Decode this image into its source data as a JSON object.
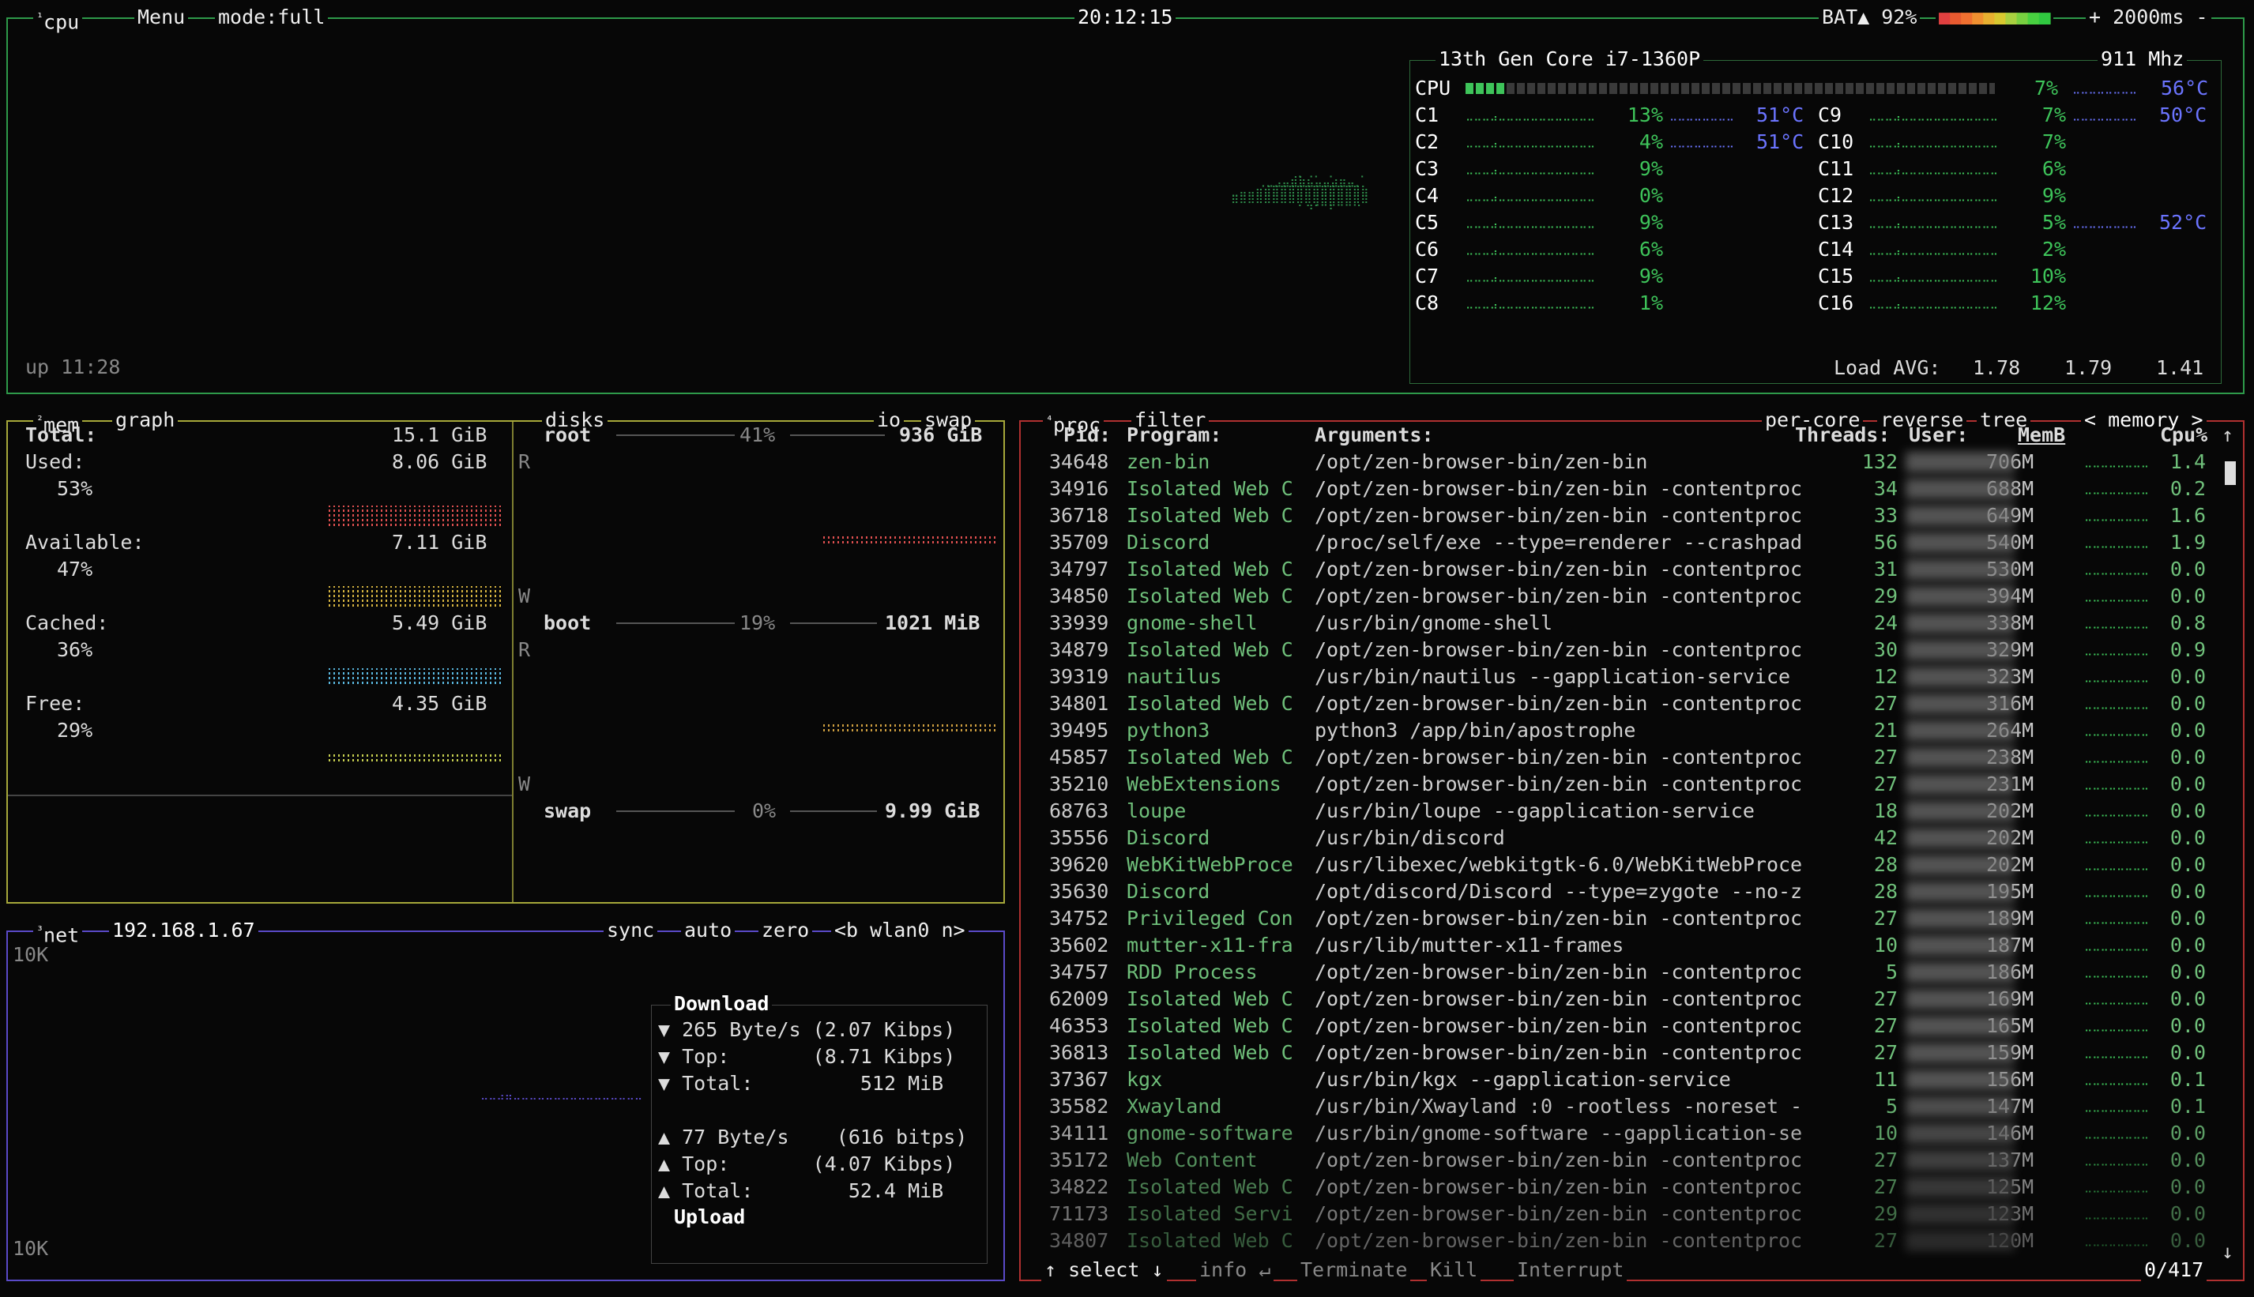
{
  "cpu_box": {
    "tab_num": "¹",
    "tab": "cpu",
    "menu": "Menu",
    "mode": "mode:full",
    "clock": "20:12:15",
    "battery": "BAT▲ 92%",
    "battery_level": 0.92,
    "refresh": "+ 2000ms -",
    "uptime": "up 11:28",
    "model": "13th Gen Core i7-1360P",
    "freq": "911 Mhz",
    "total": {
      "label": "CPU",
      "pct": "7%",
      "temp": "56°C",
      "value": 7
    },
    "cores_left": [
      {
        "name": "C1",
        "pct": "13%",
        "temp": "51°C"
      },
      {
        "name": "C2",
        "pct": "4%",
        "temp": "51°C"
      },
      {
        "name": "C3",
        "pct": "9%",
        "temp": ""
      },
      {
        "name": "C4",
        "pct": "0%",
        "temp": ""
      },
      {
        "name": "C5",
        "pct": "9%",
        "temp": ""
      },
      {
        "name": "C6",
        "pct": "6%",
        "temp": ""
      },
      {
        "name": "C7",
        "pct": "9%",
        "temp": ""
      },
      {
        "name": "C8",
        "pct": "1%",
        "temp": ""
      }
    ],
    "cores_right": [
      {
        "name": "C9",
        "pct": "7%",
        "temp": "50°C"
      },
      {
        "name": "C10",
        "pct": "7%",
        "temp": ""
      },
      {
        "name": "C11",
        "pct": "6%",
        "temp": ""
      },
      {
        "name": "C12",
        "pct": "9%",
        "temp": ""
      },
      {
        "name": "C13",
        "pct": "5%",
        "temp": "52°C"
      },
      {
        "name": "C14",
        "pct": "2%",
        "temp": ""
      },
      {
        "name": "C15",
        "pct": "10%",
        "temp": ""
      },
      {
        "name": "C16",
        "pct": "12%",
        "temp": ""
      }
    ],
    "load_label": "Load AVG:",
    "load": [
      "1.78",
      "1.79",
      "1.41"
    ]
  },
  "mem_box": {
    "tab_num": "²",
    "tab": "mem",
    "graph": "graph",
    "disks": "disks",
    "io": "io",
    "swap": "swap",
    "total_label": "Total:",
    "total": "15.1 GiB",
    "used_label": "Used:",
    "used": "8.06 GiB",
    "used_pct": "53%",
    "avail_label": "Available:",
    "avail": "7.11 GiB",
    "avail_pct": "47%",
    "cached_label": "Cached:",
    "cached": "5.49 GiB",
    "cached_pct": "36%",
    "free_label": "Free:",
    "free": "4.35 GiB",
    "free_pct": "29%",
    "disk_list": [
      {
        "name": "root",
        "pct": "41%",
        "size": "936 GiB"
      },
      {
        "name": "boot",
        "pct": "19%",
        "size": "1021 MiB"
      },
      {
        "name": "swap",
        "pct": "0%",
        "size": "9.99 GiB"
      }
    ],
    "r": "R",
    "w": "W"
  },
  "net_box": {
    "tab_num": "³",
    "tab": "net",
    "ip": "192.168.1.67",
    "sync": "sync",
    "auto": "auto",
    "zero": "zero",
    "iface": "<b wlan0 n>",
    "scale_top": "10K",
    "scale_bottom": "10K",
    "download_title": "Download",
    "upload_title": "Upload",
    "down": [
      "▼ 265 Byte/s (2.07 Kibps)",
      "▼ Top:       (8.71 Kibps)",
      "▼ Total:         512 MiB"
    ],
    "up": [
      "▲ 77 Byte/s    (616 bitps)",
      "▲ Top:       (4.07 Kibps)",
      "▲ Total:        52.4 MiB"
    ]
  },
  "proc_box": {
    "tab_num": "⁴",
    "tab": "proc",
    "filter": "filter",
    "per_core": "per-core",
    "reverse": "reverse",
    "tree": "tree",
    "sort": "< memory >",
    "headers": {
      "pid": "Pid:",
      "program": "Program:",
      "args": "Arguments:",
      "threads": "Threads:",
      "user": "User:",
      "mem": "MemB",
      "cpu": "Cpu%"
    },
    "rows": [
      [
        "34648",
        "zen-bin",
        "/opt/zen-browser-bin/zen-bin",
        "132",
        "706M",
        "1.4"
      ],
      [
        "34916",
        "Isolated Web C",
        "/opt/zen-browser-bin/zen-bin -contentproc",
        "34",
        "688M",
        "0.2"
      ],
      [
        "36718",
        "Isolated Web C",
        "/opt/zen-browser-bin/zen-bin -contentproc",
        "33",
        "649M",
        "1.6"
      ],
      [
        "35709",
        "Discord",
        "/proc/self/exe --type=renderer --crashpad",
        "56",
        "540M",
        "1.9"
      ],
      [
        "34797",
        "Isolated Web C",
        "/opt/zen-browser-bin/zen-bin -contentproc",
        "31",
        "530M",
        "0.0"
      ],
      [
        "34850",
        "Isolated Web C",
        "/opt/zen-browser-bin/zen-bin -contentproc",
        "29",
        "394M",
        "0.0"
      ],
      [
        "33939",
        "gnome-shell",
        "/usr/bin/gnome-shell",
        "24",
        "338M",
        "0.8"
      ],
      [
        "34879",
        "Isolated Web C",
        "/opt/zen-browser-bin/zen-bin -contentproc",
        "30",
        "329M",
        "0.9"
      ],
      [
        "39319",
        "nautilus",
        "/usr/bin/nautilus --gapplication-service",
        "12",
        "323M",
        "0.0"
      ],
      [
        "34801",
        "Isolated Web C",
        "/opt/zen-browser-bin/zen-bin -contentproc",
        "27",
        "316M",
        "0.0"
      ],
      [
        "39495",
        "python3",
        "python3 /app/bin/apostrophe",
        "21",
        "264M",
        "0.0"
      ],
      [
        "45857",
        "Isolated Web C",
        "/opt/zen-browser-bin/zen-bin -contentproc",
        "27",
        "238M",
        "0.0"
      ],
      [
        "35210",
        "WebExtensions",
        "/opt/zen-browser-bin/zen-bin -contentproc",
        "27",
        "231M",
        "0.0"
      ],
      [
        "68763",
        "loupe",
        "/usr/bin/loupe --gapplication-service",
        "18",
        "202M",
        "0.0"
      ],
      [
        "35556",
        "Discord",
        "/usr/bin/discord",
        "42",
        "202M",
        "0.0"
      ],
      [
        "39620",
        "WebKitWebProce",
        "/usr/libexec/webkitgtk-6.0/WebKitWebProce",
        "28",
        "202M",
        "0.0"
      ],
      [
        "35630",
        "Discord",
        "/opt/discord/Discord --type=zygote --no-z",
        "28",
        "195M",
        "0.0"
      ],
      [
        "34752",
        "Privileged Con",
        "/opt/zen-browser-bin/zen-bin -contentproc",
        "27",
        "189M",
        "0.0"
      ],
      [
        "35602",
        "mutter-x11-fra",
        "/usr/lib/mutter-x11-frames",
        "10",
        "187M",
        "0.0"
      ],
      [
        "34757",
        "RDD Process",
        "/opt/zen-browser-bin/zen-bin -contentproc",
        "5",
        "186M",
        "0.0"
      ],
      [
        "62009",
        "Isolated Web C",
        "/opt/zen-browser-bin/zen-bin -contentproc",
        "27",
        "169M",
        "0.0"
      ],
      [
        "46353",
        "Isolated Web C",
        "/opt/zen-browser-bin/zen-bin -contentproc",
        "27",
        "165M",
        "0.0"
      ],
      [
        "36813",
        "Isolated Web C",
        "/opt/zen-browser-bin/zen-bin -contentproc",
        "27",
        "159M",
        "0.0"
      ],
      [
        "37367",
        "kgx",
        "/usr/bin/kgx --gapplication-service",
        "11",
        "156M",
        "0.1"
      ],
      [
        "35582",
        "Xwayland",
        "/usr/bin/Xwayland :0 -rootless -noreset -",
        "5",
        "147M",
        "0.1"
      ],
      [
        "34111",
        "gnome-software",
        "/usr/bin/gnome-software --gapplication-se",
        "10",
        "146M",
        "0.0"
      ],
      [
        "35172",
        "Web Content",
        "/opt/zen-browser-bin/zen-bin -contentproc",
        "27",
        "137M",
        "0.0"
      ],
      [
        "34822",
        "Isolated Web C",
        "/opt/zen-browser-bin/zen-bin -contentproc",
        "27",
        "125M",
        "0.0"
      ],
      [
        "71173",
        "Isolated Servi",
        "/opt/zen-browser-bin/zen-bin -contentproc",
        "29",
        "123M",
        "0.0"
      ],
      [
        "34807",
        "Isolated Web C",
        "/opt/zen-browser-bin/zen-bin -contentproc",
        "27",
        "120M",
        "0.0"
      ]
    ],
    "footer": {
      "select": "↑ select ↓",
      "info": "info ↵",
      "terminate": "Terminate",
      "kill": "Kill",
      "interrupt": "Interrupt",
      "count": "0/417"
    }
  },
  "colors": {
    "cpu_border": "#2e9a4a",
    "mem_border": "#a6a83a",
    "net_border": "#5a4ac8",
    "proc_border": "#b03030"
  }
}
